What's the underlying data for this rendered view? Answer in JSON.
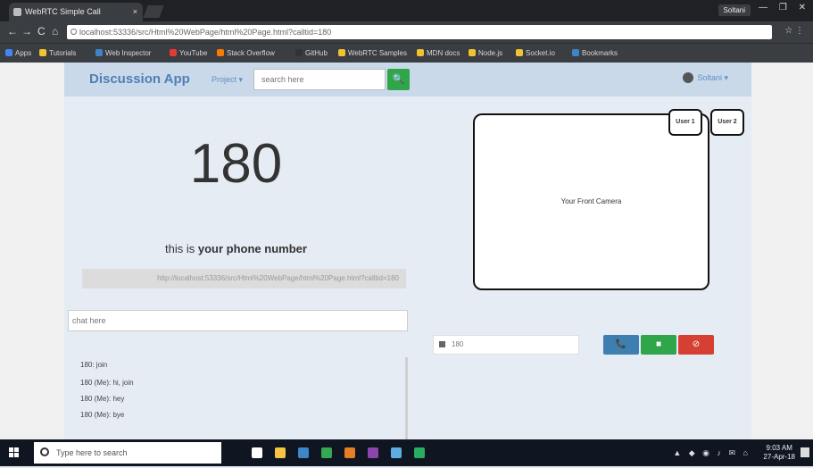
{
  "browser": {
    "tab_title": "WebRTC Simple Call",
    "tab_close": "×",
    "window_controls": [
      "—",
      "❐",
      "✕"
    ],
    "profile_name": "Soltani",
    "nav_buttons": [
      "←",
      "→",
      "C",
      "⌂"
    ],
    "url": "localhost:53336/src/Html%20WebPage/html%20Page.html?calltid=180",
    "toolbar_right": [
      "☆",
      "⋮"
    ],
    "bookmarks": [
      {
        "label": "Apps",
        "color": "#4285f4"
      },
      {
        "label": "Tutorials",
        "color": "#f1c232"
      },
      {
        "label": "Web Inspector",
        "color": "#3d85c6"
      },
      {
        "label": "YouTube",
        "color": "#e53935"
      },
      {
        "label": "Stack Overflow",
        "color": "#f57c00"
      },
      {
        "label": "GitHub",
        "color": "#333333"
      },
      {
        "label": "WebRTC Samples",
        "color": "#f1c232"
      },
      {
        "label": "MDN docs",
        "color": "#f1c232"
      },
      {
        "label": "Node.js",
        "color": "#f1c232"
      },
      {
        "label": "Socket.io",
        "color": "#f1c232"
      },
      {
        "label": "Bookmarks",
        "color": "#3d85c6"
      }
    ]
  },
  "app": {
    "brand": "Discussion App",
    "nav_link": "Project ▾",
    "search_placeholder": "search here",
    "search_icon": "🔍",
    "user_menu": "Soltani ▾"
  },
  "left": {
    "number": "180",
    "caption_prefix": "this is ",
    "caption_bold": "your phone number",
    "share_url": "http://localhost:53336/src/Html%20WebPage/html%20Page.html?calltid=180",
    "chat_placeholder": "chat here",
    "messages": [
      "180: join",
      "180 (Me): hi, join",
      "180 (Me): hey",
      "180 (Me): bye"
    ]
  },
  "right": {
    "camera_label": "Your Front Camera",
    "user1_label": "User 1",
    "user2_label": "User 2",
    "call_number_value": "180",
    "voice_icon": "📞",
    "video_icon": "■",
    "hangup_icon": "⊘"
  },
  "taskbar": {
    "search_placeholder": "Type here to search",
    "tray_icons": "▲ ◆ ◉ ♪ ✉ ⌂",
    "time": "9:03 AM",
    "date": "27-Apr-18",
    "apps": [
      {
        "name": "task-view",
        "color": "#ffffff"
      },
      {
        "name": "file-explorer",
        "color": "#f6c343"
      },
      {
        "name": "store",
        "color": "#3d85c6"
      },
      {
        "name": "chrome",
        "color": "#34a853"
      },
      {
        "name": "matlab",
        "color": "#e67e22"
      },
      {
        "name": "visual-studio",
        "color": "#8e44ad"
      },
      {
        "name": "notepad",
        "color": "#5dade2"
      },
      {
        "name": "terminal",
        "color": "#27ae60"
      }
    ]
  }
}
